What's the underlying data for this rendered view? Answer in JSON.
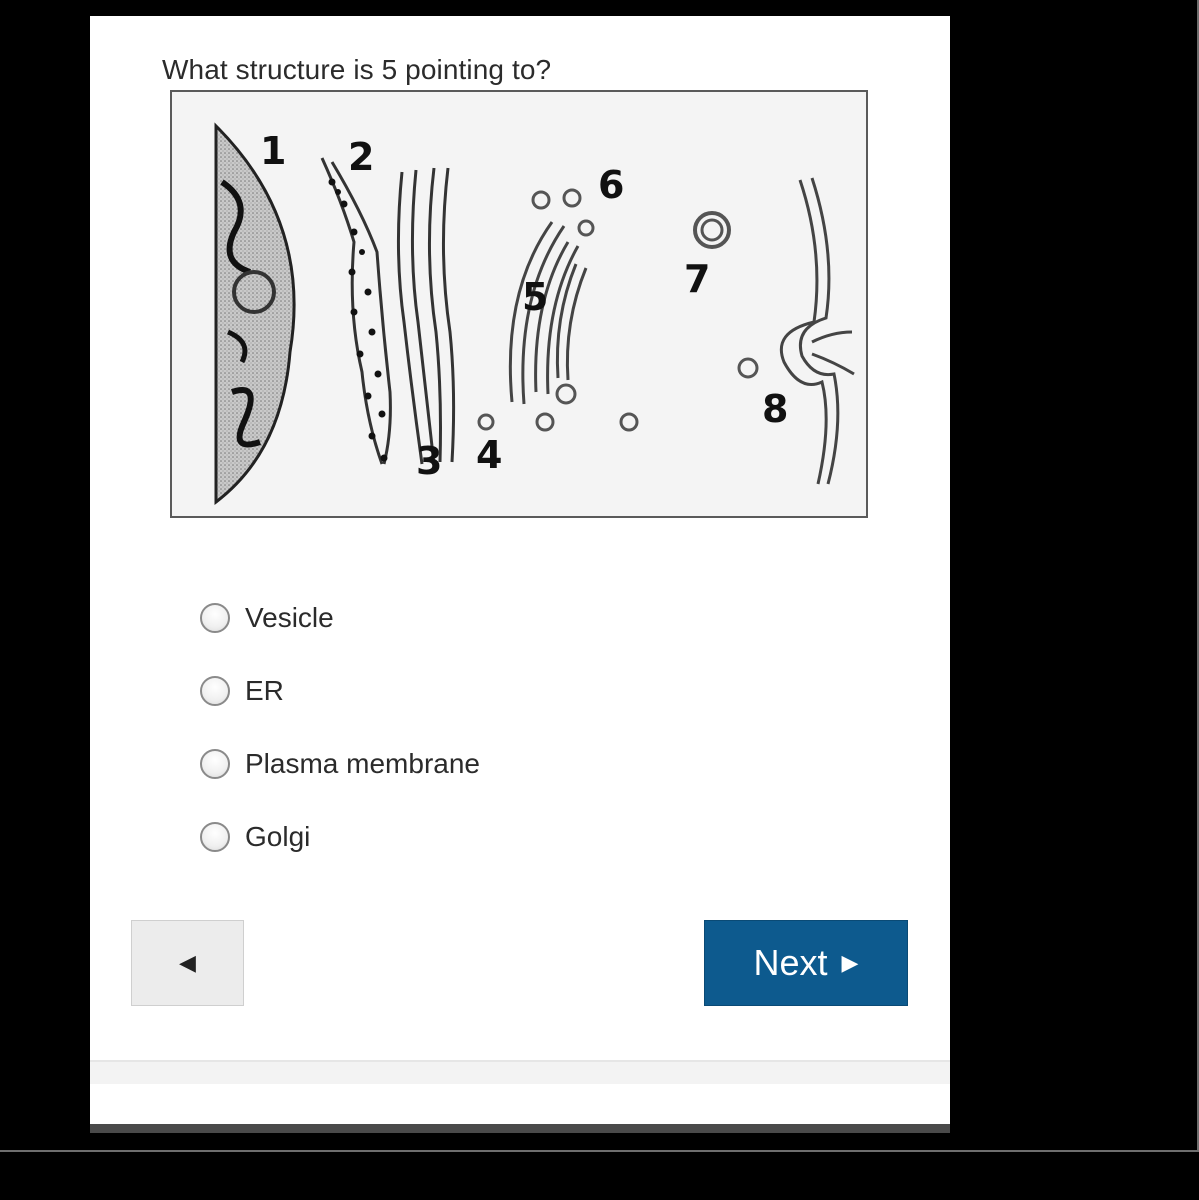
{
  "question": {
    "text": "What structure is 5  pointing to?"
  },
  "figure": {
    "labels": [
      "1",
      "2",
      "3",
      "4",
      "5",
      "6",
      "7",
      "8"
    ]
  },
  "options": [
    {
      "label": "Vesicle",
      "selected": false
    },
    {
      "label": "ER",
      "selected": false
    },
    {
      "label": "Plasma membrane",
      "selected": false
    },
    {
      "label": "Golgi",
      "selected": false
    }
  ],
  "nav": {
    "prev_symbol": "◀",
    "next_label": "Next",
    "next_symbol": "▶"
  },
  "colors": {
    "next_button": "#0d5a8e",
    "prev_button": "#ececec"
  },
  "icons": {
    "prev": "left-triangle-icon",
    "next": "right-triangle-icon"
  }
}
